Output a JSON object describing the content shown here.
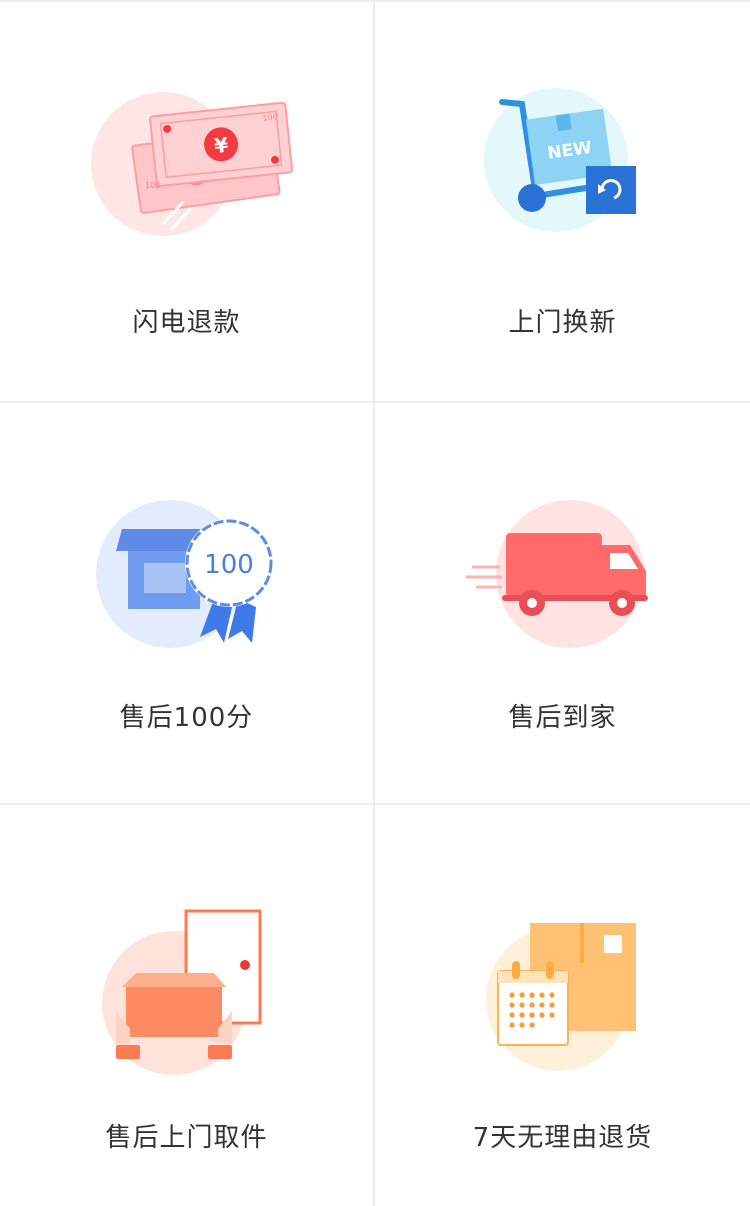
{
  "services": [
    {
      "label": "闪电退款",
      "icon": "flash-refund-icon",
      "accent": "#f2585a"
    },
    {
      "label": "上门换新",
      "icon": "home-replacement-icon",
      "accent": "#2b72d6"
    },
    {
      "label": "售后100分",
      "icon": "aftersales-100-icon",
      "accent": "#4c8cf2",
      "badge_text": "100"
    },
    {
      "label": "售后到家",
      "icon": "delivery-truck-icon",
      "accent": "#ff6a6a"
    },
    {
      "label": "售后上门取件",
      "icon": "door-pickup-icon",
      "accent": "#ff8a64"
    },
    {
      "label": "7天无理由退货",
      "icon": "seven-day-return-icon",
      "accent": "#ffb24f"
    }
  ],
  "icon_texts": {
    "currency": "¥",
    "note_value": "100",
    "new_label": "NEW"
  }
}
